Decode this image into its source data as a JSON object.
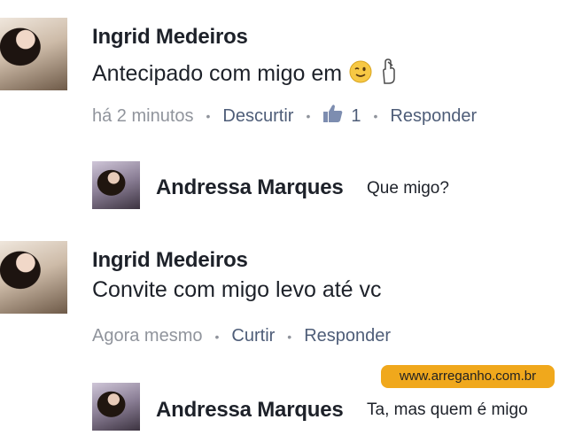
{
  "comments": [
    {
      "author": "Ingrid Medeiros",
      "text": "Antecipado com migo em",
      "time": "há 2 minutos",
      "action_like": "Descurtir",
      "like_count": "1",
      "action_reply": "Responder",
      "reply": {
        "author": "Andressa Marques",
        "text": "Que migo?"
      }
    },
    {
      "author": "Ingrid Medeiros",
      "text": "Convite com migo levo até vc",
      "time": "Agora mesmo",
      "action_like": "Curtir",
      "action_reply": "Responder",
      "reply": {
        "author": "Andressa Marques",
        "text": "Ta, mas quem é migo"
      }
    }
  ],
  "watermark": "www.arreganho.com.br",
  "icons": [
    "winking-face-icon",
    "crossed-fingers-icon",
    "thumbs-up-icon"
  ],
  "colors": {
    "link": "#4e5d78",
    "muted": "#90949c",
    "text": "#1d2129",
    "watermark_bg": "#f0a81c"
  }
}
